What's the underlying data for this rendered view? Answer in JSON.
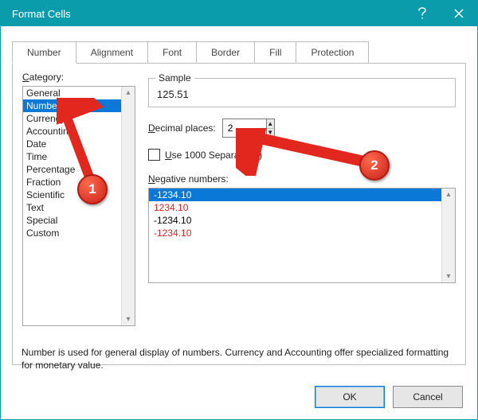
{
  "window": {
    "title": "Format Cells"
  },
  "tabs": {
    "items": [
      {
        "label": "Number"
      },
      {
        "label": "Alignment"
      },
      {
        "label": "Font"
      },
      {
        "label": "Border"
      },
      {
        "label": "Fill"
      },
      {
        "label": "Protection"
      }
    ],
    "active_index": 0
  },
  "category": {
    "label": "Category:",
    "items": [
      "General",
      "Number",
      "Currency",
      "Accounting",
      "Date",
      "Time",
      "Percentage",
      "Fraction",
      "Scientific",
      "Text",
      "Special",
      "Custom"
    ],
    "selected_index": 1
  },
  "sample": {
    "label": "Sample",
    "value": "125.51"
  },
  "decimal": {
    "label": "Decimal places:",
    "value": "2"
  },
  "separator": {
    "label": "Use 1000 Separator (,)",
    "checked": false
  },
  "negative": {
    "label": "Negative numbers:",
    "items": [
      {
        "text": "-1234.10",
        "color": "#ffffff"
      },
      {
        "text": "1234.10",
        "color": "#d22"
      },
      {
        "text": "-1234.10",
        "color": "#000"
      },
      {
        "text": "-1234.10",
        "color": "#d22"
      }
    ],
    "selected_index": 0
  },
  "description": "Number is used for general display of numbers.  Currency and Accounting offer specialized formatting for monetary value.",
  "buttons": {
    "ok": "OK",
    "cancel": "Cancel"
  },
  "callouts": {
    "one": "1",
    "two": "2"
  }
}
